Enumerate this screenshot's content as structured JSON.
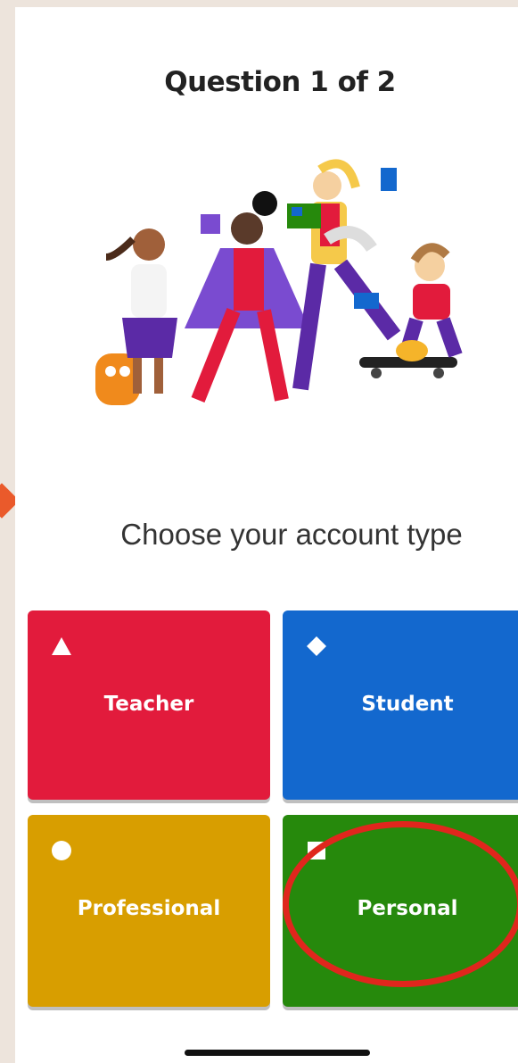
{
  "header": {
    "title": "Question 1 of 2"
  },
  "prompt": {
    "subtitle": "Choose your account type"
  },
  "options": [
    {
      "label": "Teacher",
      "shape": "triangle-icon",
      "color": "#e21b3c"
    },
    {
      "label": "Student",
      "shape": "diamond-icon",
      "color": "#1368ce"
    },
    {
      "label": "Professional",
      "shape": "circle-icon",
      "color": "#d89e00"
    },
    {
      "label": "Personal",
      "shape": "square-icon",
      "color": "#26890c"
    }
  ],
  "annotation": {
    "highlight_color": "#e0261d"
  }
}
